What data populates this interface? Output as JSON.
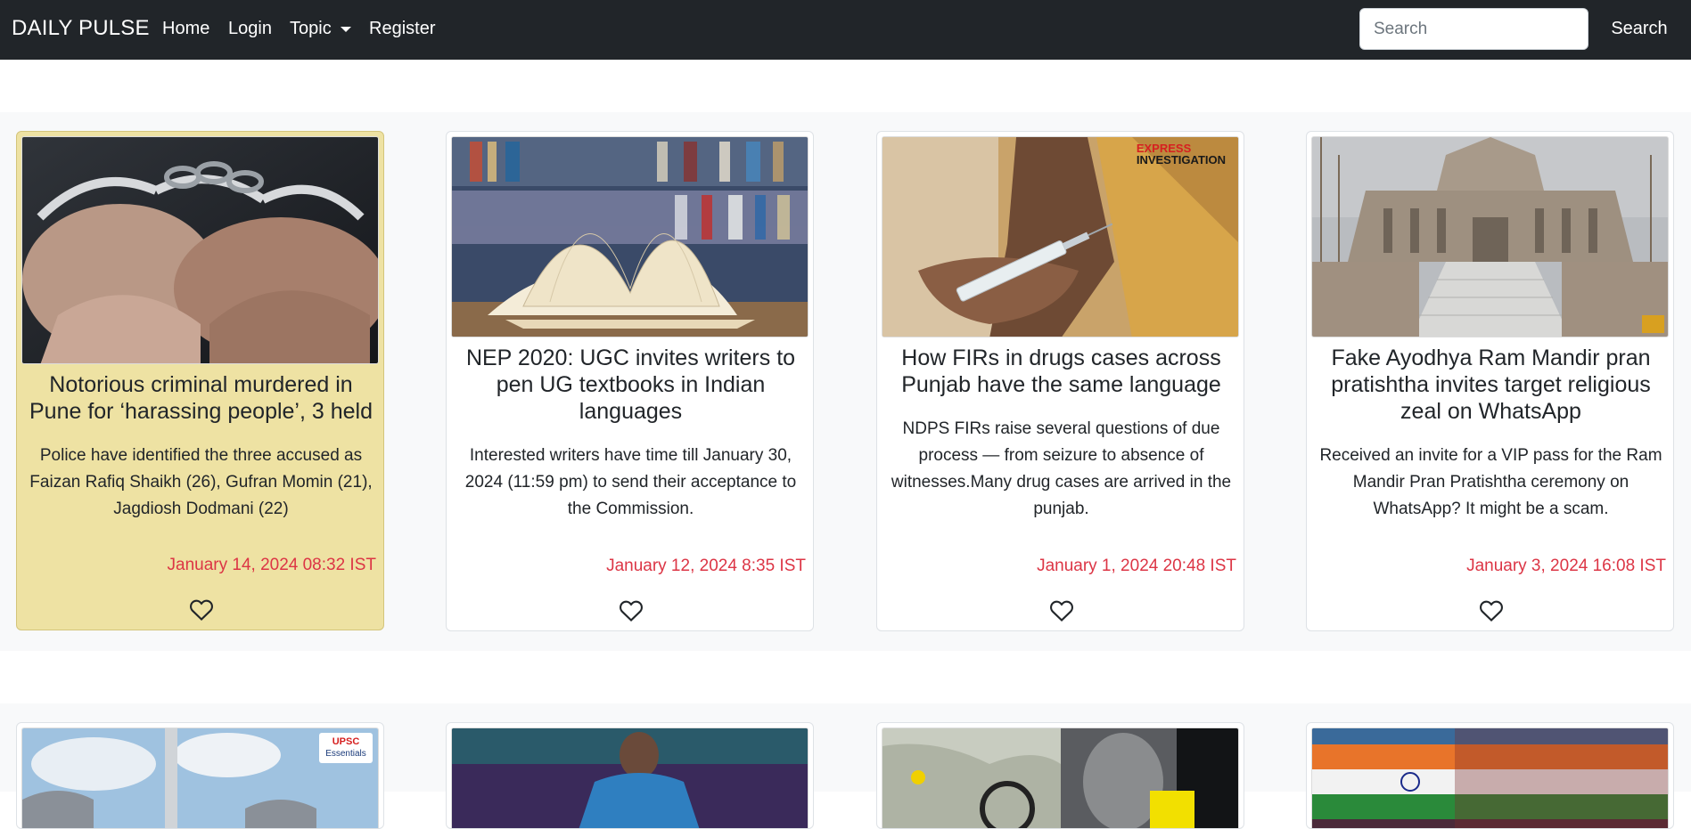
{
  "nav": {
    "brand": "DAILY PULSE",
    "home": "Home",
    "login": "Login",
    "topic": "Topic",
    "register": "Register",
    "search_placeholder": "Search",
    "search_button": "Search"
  },
  "articles": [
    {
      "title": "Notorious criminal murdered in Pune for ‘harassing people’, 3 held",
      "summary": "Police have identified the three accused as Faizan Rafiq Shaikh (26), Gufran Momin (21), Jagdiosh Dodmani (22)",
      "date": "January 14, 2024 08:32 IST",
      "image": "handcuffed-hands"
    },
    {
      "title": "NEP 2020: UGC invites writers to pen UG textbooks in Indian languages",
      "summary": "Interested writers have time till January 30, 2024 (11:59 pm) to send their acceptance to the Commission.",
      "date": "January 12, 2024 8:35 IST",
      "image": "open-book-library"
    },
    {
      "title": "How FIRs in drugs cases across Punjab have the same language",
      "summary": "NDPS FIRs raise several questions of due process — from seizure to absence of witnesses.Many drug cases are arrived in the punjab.",
      "date": "January 1, 2024 20:48 IST",
      "image": "hand-holding-syringe",
      "image_badge_line1": "EXPRESS",
      "image_badge_line2": "INVESTIGATION"
    },
    {
      "title": "Fake Ayodhya Ram Mandir pran pratishtha invites target religious zeal on WhatsApp",
      "summary": "Received an invite for a VIP pass for the Ram Mandir Pran Pratishtha ceremony on WhatsApp? It might be a scam.",
      "date": "January 3, 2024 16:08 IST",
      "image": "temple-construction"
    }
  ],
  "second_row": [
    {
      "image": "power-plant-chimney",
      "badge_line1": "UPSC",
      "badge_line2": "Essentials"
    },
    {
      "image": "athlete-player"
    },
    {
      "image": "map-and-man"
    },
    {
      "image": "indian-flag"
    }
  ],
  "colors": {
    "navbar": "#212529",
    "section_bg": "#f8f9fa",
    "highlight_card": "#eee2a3",
    "date": "#dc3545"
  }
}
